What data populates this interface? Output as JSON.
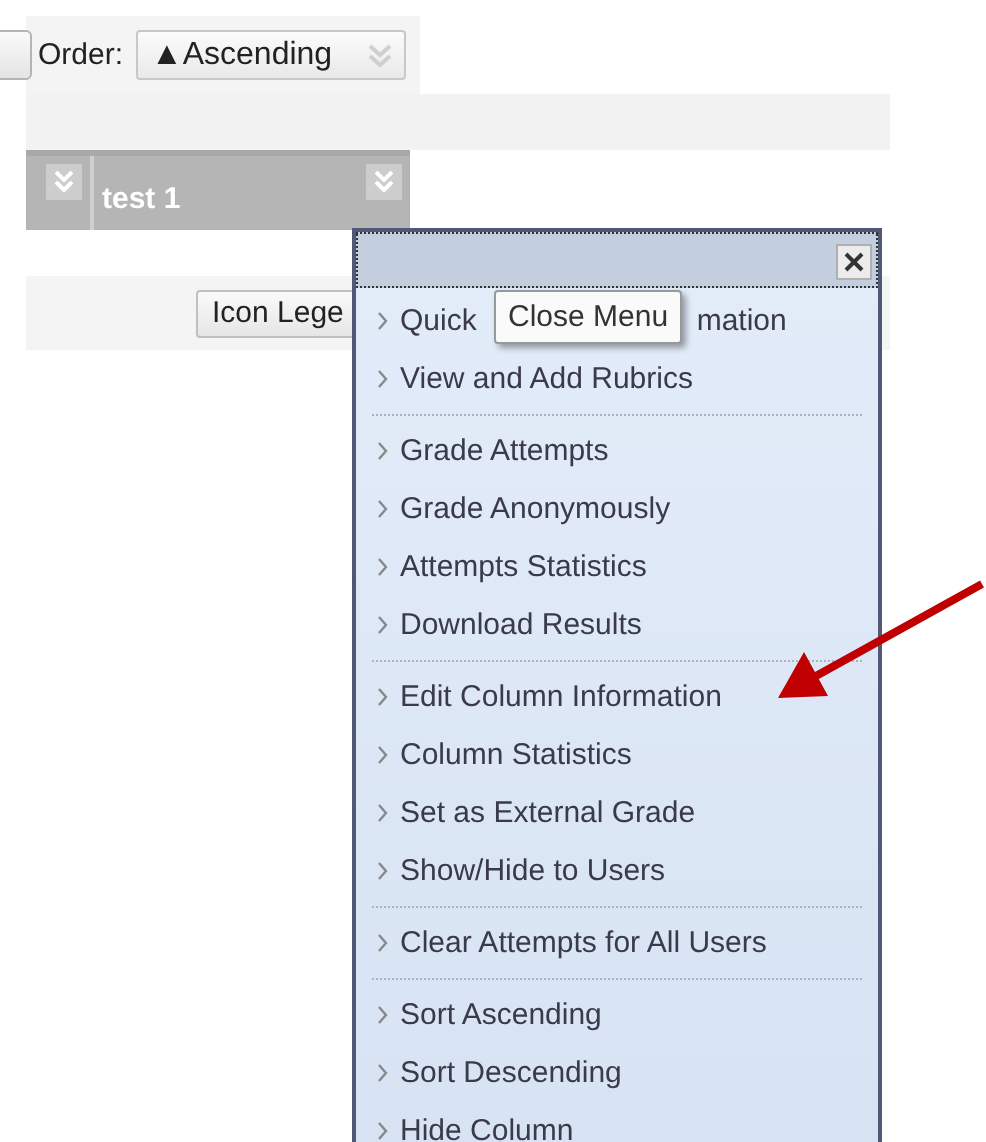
{
  "toolbar": {
    "order_label": "Order:",
    "order_select": {
      "value": "▲Ascending"
    }
  },
  "grid_header": {
    "columns": [
      {
        "kind": "menu-only"
      },
      {
        "kind": "titled",
        "title": "test 1"
      }
    ]
  },
  "legend_button": {
    "label": "Icon Lege"
  },
  "column_menu": {
    "groups": [
      [
        {
          "label": "Quick",
          "label_after_tooltip": "mation"
        },
        {
          "label": "View and Add Rubrics"
        }
      ],
      [
        {
          "label": "Grade Attempts"
        },
        {
          "label": "Grade Anonymously"
        },
        {
          "label": "Attempts Statistics"
        },
        {
          "label": "Download Results"
        }
      ],
      [
        {
          "label": "Edit Column Information"
        },
        {
          "label": "Column Statistics"
        },
        {
          "label": "Set as External Grade"
        },
        {
          "label": "Show/Hide to Users"
        }
      ],
      [
        {
          "label": "Clear Attempts for All Users"
        }
      ],
      [
        {
          "label": "Sort Ascending"
        },
        {
          "label": "Sort Descending"
        },
        {
          "label": "Hide Column"
        }
      ]
    ],
    "tooltip": "Close Menu"
  }
}
